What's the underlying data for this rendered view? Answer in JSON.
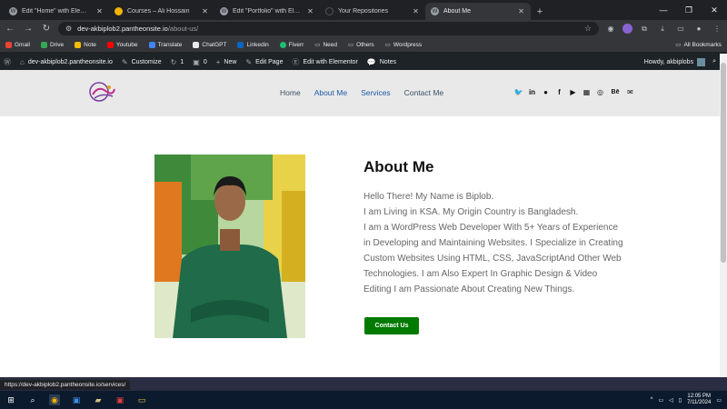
{
  "browser": {
    "tabs": [
      {
        "title": "Edit \"Home\" with Elementor",
        "icon": "wordpress-icon",
        "active": false
      },
      {
        "title": "Courses – Ali Hossain",
        "icon": "site-favicon",
        "active": false
      },
      {
        "title": "Edit \"Portfolio\" with Elementor",
        "icon": "wordpress-icon",
        "active": false
      },
      {
        "title": "Your Repositories",
        "icon": "github-icon",
        "active": false
      },
      {
        "title": "About Me",
        "icon": "wordpress-icon",
        "active": true
      }
    ],
    "url_host": "dev-akbiplob2.pantheonsite.io",
    "url_path": "/about-us/",
    "bookmarks": [
      {
        "label": "Gmail",
        "color": "#ea4335"
      },
      {
        "label": "Drive",
        "color": "#34a853"
      },
      {
        "label": "Note",
        "color": "#fbbc04"
      },
      {
        "label": "Youtube",
        "color": "#ff0000"
      },
      {
        "label": "Translate",
        "color": "#4285f4"
      },
      {
        "label": "ChatGPT",
        "color": "#e8eaed"
      },
      {
        "label": "Linkedin",
        "color": "#0a66c2"
      },
      {
        "label": "Fiverr",
        "color": "#1dbf73"
      },
      {
        "label": "Need",
        "color": "#9aa0a6"
      },
      {
        "label": "Others",
        "color": "#9aa0a6"
      },
      {
        "label": "Wordpress",
        "color": "#9aa0a6"
      }
    ],
    "all_bookmarks": "All Bookmarks",
    "status_url": "https://dev-akbiplob2.pantheonsite.io/services/"
  },
  "wpbar": {
    "site": "dev-akbiplob2.pantheonsite.io",
    "customize": "Customize",
    "updates": "1",
    "comments": "0",
    "new": "New",
    "edit_page": "Edit Page",
    "elementor": "Edit with Elementor",
    "notes": "Notes",
    "howdy": "Howdy, akbiplobs"
  },
  "site": {
    "nav": [
      "Home",
      "About Me",
      "Services",
      "Contact Me"
    ],
    "current_nav": "About Me",
    "social_icons": [
      "twitter-icon",
      "linkedin-icon",
      "github-icon",
      "facebook-icon",
      "youtube-icon",
      "codepen-icon",
      "dribbble-icon",
      "behance-icon",
      "email-icon"
    ],
    "heading": "About Me",
    "para_lines": [
      "Hello There! My Name is Biplob.",
      "I am Living in KSA. My Origin Country is Bangladesh.",
      "I am a WordPress Web Developer With 5+ Years of Experience in Developing and Maintaining Websites. I Specialize in Creating Custom Websites Using HTML, CSS, JavaScriptAnd Other Web Technologies. I am Also Expert In Graphic Design & Video Editing I am Passionate About Creating New Things."
    ],
    "button": "Contact Us",
    "accent": "#007a00"
  },
  "taskbar": {
    "time": "12:05 PM",
    "date": "7/11/2024"
  }
}
